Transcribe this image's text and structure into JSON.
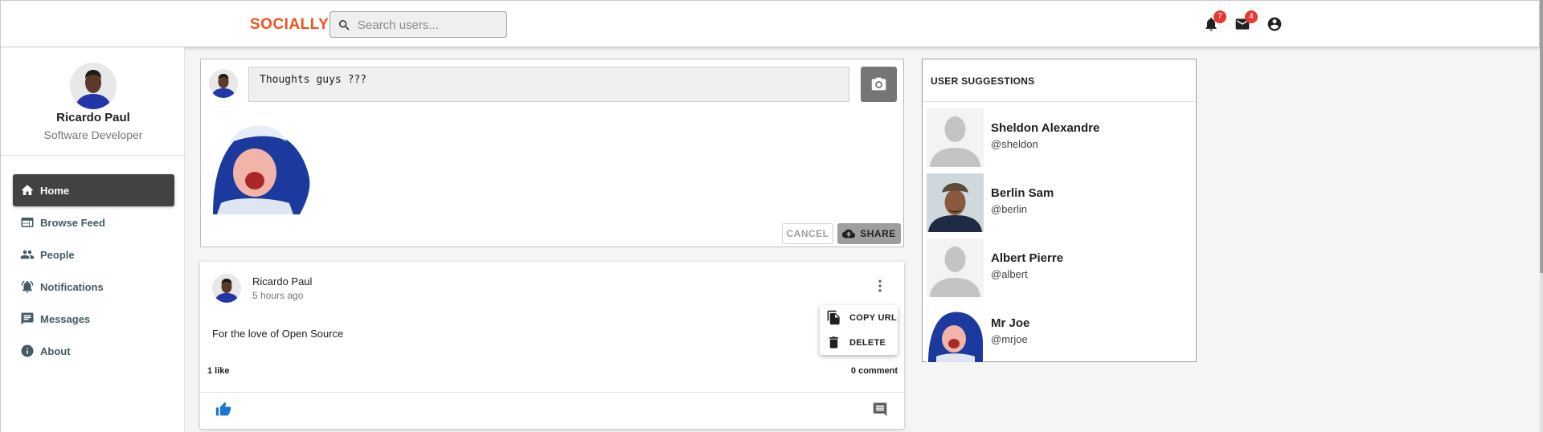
{
  "header": {
    "brand": "SOCIALLY",
    "search_placeholder": "Search users...",
    "notifications_count": "7",
    "messages_count": "4",
    "brand_color": "#f4511e",
    "badge_color": "#e53935"
  },
  "sidebar": {
    "user_name": "Ricardo Paul",
    "user_role": "Software Developer",
    "items": [
      {
        "label": "Home",
        "icon": "home-icon",
        "active": true
      },
      {
        "label": "Browse Feed",
        "icon": "feed-icon",
        "active": false
      },
      {
        "label": "People",
        "icon": "people-icon",
        "active": false
      },
      {
        "label": "Notifications",
        "icon": "notifications-icon",
        "active": false
      },
      {
        "label": "Messages",
        "icon": "messages-icon",
        "active": false
      },
      {
        "label": "About",
        "icon": "info-icon",
        "active": false
      }
    ]
  },
  "composer": {
    "text": "Thoughts guys ???",
    "cancel_label": "CANCEL",
    "share_label": "SHARE"
  },
  "post": {
    "author": "Ricardo Paul",
    "time": "5 hours ago",
    "text": "For the love of Open Source",
    "likes": "1 like",
    "comments": "0 comment",
    "menu": {
      "copy_url": "COPY URL",
      "delete": "DELETE"
    }
  },
  "suggestions": {
    "title": "USER SUGGESTIONS",
    "users": [
      {
        "name": "Sheldon Alexandre",
        "handle": "@sheldon",
        "avatar": "default-avatar"
      },
      {
        "name": "Berlin Sam",
        "handle": "@berlin",
        "avatar": "photo-avatar"
      },
      {
        "name": "Albert Pierre",
        "handle": "@albert",
        "avatar": "default-avatar"
      },
      {
        "name": "Mr Joe",
        "handle": "@mrjoe",
        "avatar": "child-photo-avatar"
      }
    ]
  }
}
